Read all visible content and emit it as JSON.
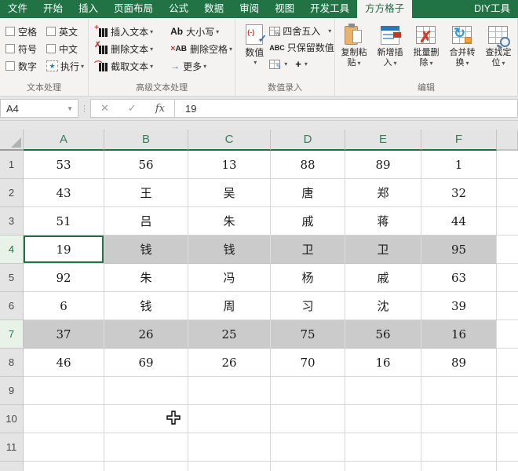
{
  "tab_bar": {
    "tabs": [
      "文件",
      "开始",
      "插入",
      "页面布局",
      "公式",
      "数据",
      "审阅",
      "视图",
      "开发工具",
      "方方格子",
      "DIY工具"
    ],
    "active_tab": "方方格子"
  },
  "ribbon": {
    "text_processing": {
      "label": "文本处理",
      "checkbox_col1": [
        "空格",
        "符号",
        "数字"
      ],
      "checkbox_col2": [
        "英文",
        "中文"
      ],
      "execute_button": "执行"
    },
    "advanced_text": {
      "label": "高级文本处理",
      "col1_buttons": [
        "插入文本",
        "删除文本",
        "截取文本"
      ],
      "col2_buttons": [
        "大小写",
        "删除空格",
        "更多"
      ],
      "case_icon_text": "Ab",
      "remove_space_icon_text": "AB"
    },
    "numeric_entry": {
      "label": "数值录入",
      "value_button": "数值",
      "round_button": "四舍五入",
      "keep_numbers_button": "只保留数值",
      "abc_icon_text": "ABC",
      "plus_icon_text": "+"
    },
    "edit": {
      "label": "编辑",
      "buttons": [
        {
          "line1": "复制粘",
          "line2": "贴"
        },
        {
          "line1": "新增插",
          "line2": "入"
        },
        {
          "line1": "批量删",
          "line2": "除"
        },
        {
          "line1": "合并转",
          "line2": "换"
        },
        {
          "line1": "查找定",
          "line2": "位"
        }
      ]
    }
  },
  "formula_bar": {
    "name_box": "A4",
    "cancel_icon": "✕",
    "enter_icon": "✓",
    "fx_label": "fx",
    "value": "19"
  },
  "grid": {
    "column_headers": [
      "A",
      "B",
      "C",
      "D",
      "E",
      "F"
    ],
    "row_headers": [
      "1",
      "2",
      "3",
      "4",
      "5",
      "6",
      "7",
      "8",
      "9",
      "10",
      "11"
    ],
    "cells": [
      [
        "53",
        "56",
        "13",
        "88",
        "89",
        "1"
      ],
      [
        "43",
        "王",
        "吴",
        "唐",
        "郑",
        "32"
      ],
      [
        "51",
        "吕",
        "朱",
        "戚",
        "蒋",
        "44"
      ],
      [
        "19",
        "钱",
        "钱",
        "卫",
        "卫",
        "95"
      ],
      [
        "92",
        "朱",
        "冯",
        "杨",
        "戚",
        "63"
      ],
      [
        "6",
        "钱",
        "周",
        "习",
        "沈",
        "39"
      ],
      [
        "37",
        "26",
        "25",
        "75",
        "56",
        "16"
      ],
      [
        "46",
        "69",
        "26",
        "70",
        "16",
        "89"
      ],
      [
        "",
        "",
        "",
        "",
        "",
        ""
      ],
      [
        "",
        "",
        "",
        "",
        "",
        ""
      ],
      [
        "",
        "",
        "",
        "",
        "",
        ""
      ]
    ],
    "active_cell": "A4",
    "selected_rows": [
      4,
      7
    ]
  },
  "colors": {
    "ribbon_green": "#217346",
    "active_tab_text": "#1e6b41",
    "selection_fill": "#cbcbcb",
    "selected_header_bg": "#e9f2e9",
    "header_underline": "#1e7145"
  }
}
